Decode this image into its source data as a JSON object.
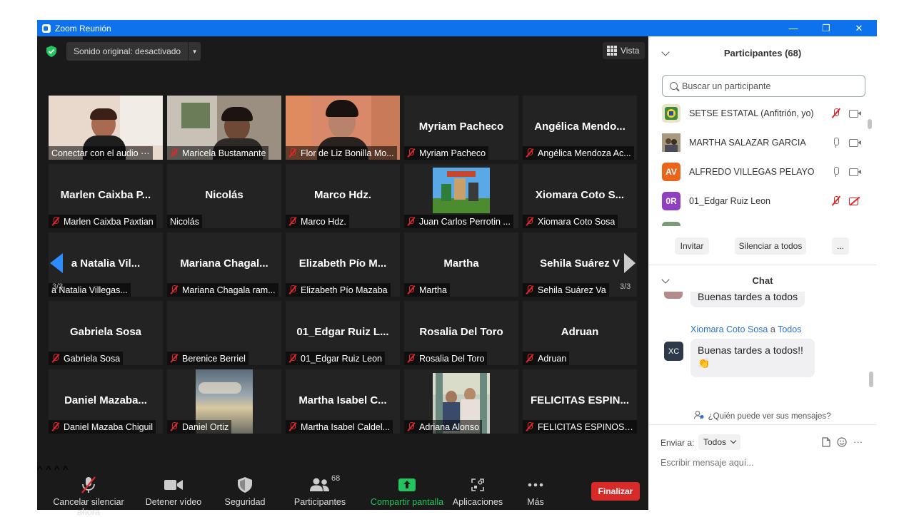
{
  "window": {
    "title": "Zoom Reunión",
    "minimize_glyph": "—",
    "restore_glyph": "❐",
    "close_glyph": "✕"
  },
  "topbar": {
    "sound_label": "Sonido original: desactivado",
    "dropdown_glyph": "▼",
    "view_label": "Vista"
  },
  "nav": {
    "page_left": "3/3",
    "page_right": "3/3"
  },
  "tiles": [
    {
      "name": "",
      "label": "Conectar con el audio ···",
      "muted": false,
      "video": true
    },
    {
      "name": "",
      "label": "Maricela Bustamante",
      "muted": true,
      "video": true
    },
    {
      "name": "",
      "label": "Flor de Liz Bonilla Mo...",
      "muted": true,
      "video": true
    },
    {
      "name": "Myriam Pacheco",
      "label": "Myriam Pacheco",
      "muted": true,
      "video": false
    },
    {
      "name": "Angélica  Mendo...",
      "label": "Angélica Mendoza Ac...",
      "muted": true,
      "video": false
    },
    {
      "name": "Marlen  Caixba  P...",
      "label": "Marlen Caixba Paxtian",
      "muted": true,
      "video": false
    },
    {
      "name": "Nicolás",
      "label": "Nicolás",
      "muted": false,
      "video": false
    },
    {
      "name": "Marco Hdz.",
      "label": "Marco Hdz.",
      "muted": true,
      "video": false
    },
    {
      "name": "",
      "label": "Juan Carlos Perrotin ...",
      "muted": true,
      "video": true
    },
    {
      "name": "Xiomara  Coto  S...",
      "label": "Xiomara Coto Sosa",
      "muted": true,
      "video": false
    },
    {
      "name": "a  Natalia  Vil...",
      "label": "a Natalia Villegas...",
      "muted": false,
      "video": false
    },
    {
      "name": "Mariana  Chagal...",
      "label": "Mariana Chagala ram...",
      "muted": true,
      "video": false
    },
    {
      "name": "Elizabeth  Pío  M...",
      "label": "Elizabeth Pío Mazaba",
      "muted": true,
      "video": false
    },
    {
      "name": "Martha",
      "label": "Martha",
      "muted": true,
      "video": false
    },
    {
      "name": "Sehila  Suárez  V",
      "label": "Sehila Suárez Va",
      "muted": true,
      "video": false
    },
    {
      "name": "Gabriela Sosa",
      "label": "Gabriela Sosa",
      "muted": true,
      "video": false
    },
    {
      "name": "",
      "label": "Berenice Berriel",
      "muted": true,
      "video": true
    },
    {
      "name": "01_Edgar  Ruiz  L...",
      "label": "01_Edgar Ruiz Leon",
      "muted": true,
      "video": false
    },
    {
      "name": "Rosalia Del Toro",
      "label": "Rosalia Del Toro",
      "muted": true,
      "video": false
    },
    {
      "name": "Adruan",
      "label": "Adruan",
      "muted": true,
      "video": false
    },
    {
      "name": "Daniel  Mazaba...",
      "label": "Daniel Mazaba Chiguil",
      "muted": true,
      "video": false
    },
    {
      "name": "",
      "label": "Daniel Ortiz",
      "muted": true,
      "video": true
    },
    {
      "name": "Martha  Isabel  C...",
      "label": "Martha Isabel Caldel...",
      "muted": true,
      "video": false
    },
    {
      "name": "",
      "label": "Adriana Alonso",
      "muted": true,
      "video": true
    },
    {
      "name": "FELICITAS  ESPIN...",
      "label": "FELICITAS ESPINOSA ...",
      "muted": true,
      "video": false
    }
  ],
  "toolbar": {
    "unmute": "Cancelar silenciar ahora",
    "video": "Detener vídeo",
    "security": "Seguridad",
    "participants": "Participantes",
    "participants_count": "68",
    "share": "Compartir pantalla",
    "apps": "Aplicaciones",
    "more": "Más",
    "end": "Finalizar",
    "caret": "^"
  },
  "participants_panel": {
    "title": "Participantes (68)",
    "search_placeholder": "Buscar un participante",
    "rows": [
      {
        "name": "SETSE ESTATAL (Anfitrión, yo)",
        "initials": "",
        "mic": "off",
        "cam": "on"
      },
      {
        "name": "MARTHA SALAZAR GARCIA",
        "initials": "",
        "mic": "on",
        "cam": "on"
      },
      {
        "name": "ALFREDO VILLEGAS PELAYO",
        "initials": "AV",
        "mic": "on",
        "cam": "on"
      },
      {
        "name": "01_Edgar Ruiz Leon",
        "initials": "0R",
        "mic": "off",
        "cam": "off"
      }
    ],
    "invite": "Invitar",
    "mute_all": "Silenciar a todos",
    "more": "..."
  },
  "chat": {
    "title": "Chat",
    "prev_message": "Buenas tardes a todos",
    "sender": "Xiomara Coto Sosa",
    "to_word": "a",
    "recipient": "Todos",
    "sender_initials": "XC",
    "message": "Buenas tardes a todos!!",
    "emoji": "👏",
    "who_can_see": "¿Quién puede ver sus mensajes?",
    "send_to_label": "Enviar a:",
    "send_to_value": "Todos",
    "input_placeholder": "Escribir mensaje aquí...",
    "more": "···"
  },
  "colors": {
    "accent": "#0e72ed",
    "danger": "#d92a2a",
    "share_green": "#23c45e",
    "chat_link": "#2d73d6"
  }
}
